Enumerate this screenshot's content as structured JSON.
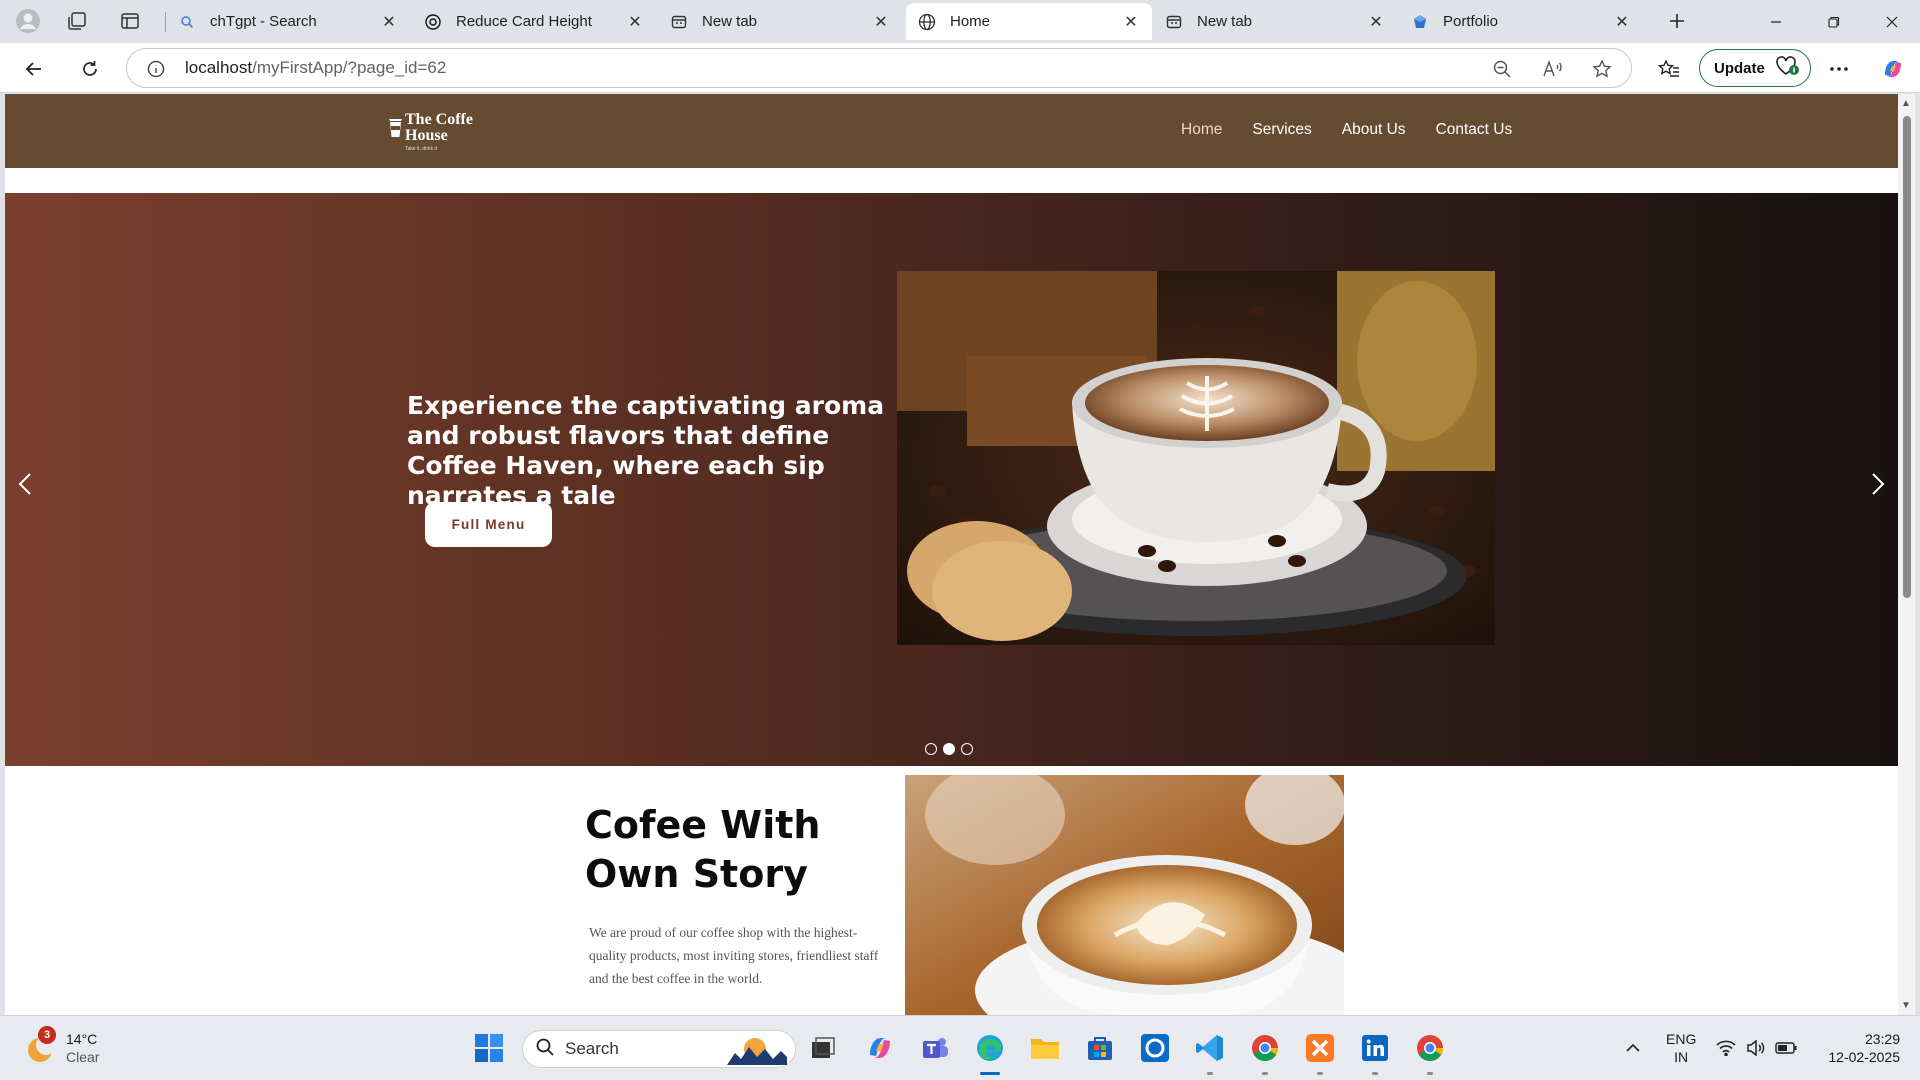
{
  "browser": {
    "tabs": [
      {
        "title": "chTgpt - Search",
        "icon": "search-icon"
      },
      {
        "title": "Reduce Card Height",
        "icon": "chatgpt-icon"
      },
      {
        "title": "New tab",
        "icon": "newtab-icon"
      },
      {
        "title": "Home",
        "icon": "globe-icon",
        "active": true
      },
      {
        "title": "New tab",
        "icon": "newtab-icon"
      },
      {
        "title": "Portfolio",
        "icon": "portfolio-icon"
      }
    ],
    "url_host": "localhost",
    "url_path": "/myFirstApp/?page_id=62",
    "update_label": "Update"
  },
  "site": {
    "logo_line1": "The Coffe",
    "logo_line2": "House",
    "logo_tagline": "Take it, drink it",
    "nav": [
      "Home",
      "Services",
      "About Us",
      "Contact Us"
    ],
    "current_nav": "Home"
  },
  "hero": {
    "headline": "Experience the captivating aroma and robust flavors that define Coffee Haven, where each sip narrates a tale",
    "button_label": "Full Menu",
    "slide_count": 3,
    "active_slide": 2
  },
  "story": {
    "title": "Cofee With Own Story",
    "body": "We are proud of our coffee shop with the highest-quality products, most inviting stores, friendliest staff and the best coffee in the world."
  },
  "taskbar": {
    "weather_temp": "14°C",
    "weather_cond": "Clear",
    "weather_badge": "3",
    "search_label": "Search",
    "lang_line1": "ENG",
    "lang_line2": "IN",
    "time": "23:29",
    "date": "12-02-2025"
  },
  "colors": {
    "header_brown": "#644b32",
    "hero_start": "#7b3f2e",
    "hero_end": "#161110",
    "update_border": "#1e7a3c",
    "accent_blue": "#0067c0"
  }
}
